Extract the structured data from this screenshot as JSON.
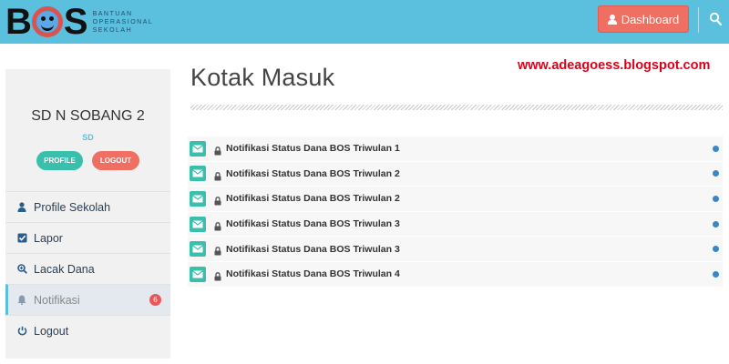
{
  "header": {
    "logo_text_b": "B",
    "logo_text_s": "S",
    "logo_sub_lines": [
      "BANTUAN",
      "OPERASIONAL",
      "SEKOLAH"
    ],
    "dashboard_label": "Dashboard",
    "search_icon": "search-icon",
    "colors": {
      "bar": "#5bc0de",
      "dashboard": "#ef6f62"
    }
  },
  "watermark": "www.adeagoess.blogspot.com",
  "sidebar": {
    "school_name": "SD N SOBANG 2",
    "school_level": "SD",
    "profile_label": "PROFILE",
    "logout_label": "LOGOUT",
    "items": [
      {
        "label": "Profile Sekolah",
        "icon": "user-icon"
      },
      {
        "label": "Lapor",
        "icon": "checkbox-icon"
      },
      {
        "label": "Lacak Dana",
        "icon": "search-plus-icon"
      },
      {
        "label": "Notifikasi",
        "icon": "bell-icon",
        "badge": "6",
        "active": true
      },
      {
        "label": "Logout",
        "icon": "power-icon"
      }
    ]
  },
  "main": {
    "title": "Kotak Masuk",
    "messages": [
      {
        "text": "Notifikasi Status Dana BOS Triwulan 1"
      },
      {
        "text": "Notifikasi Status Dana BOS Triwulan 2"
      },
      {
        "text": "Notifikasi Status Dana BOS Triwulan 2"
      },
      {
        "text": "Notifikasi Status Dana BOS Triwulan 3"
      },
      {
        "text": "Notifikasi Status Dana BOS Triwulan 3"
      },
      {
        "text": "Notifikasi Status Dana BOS Triwulan 4"
      }
    ],
    "colors": {
      "envelope": "#3bbfad",
      "unread_dot": "#3a86c8"
    }
  }
}
